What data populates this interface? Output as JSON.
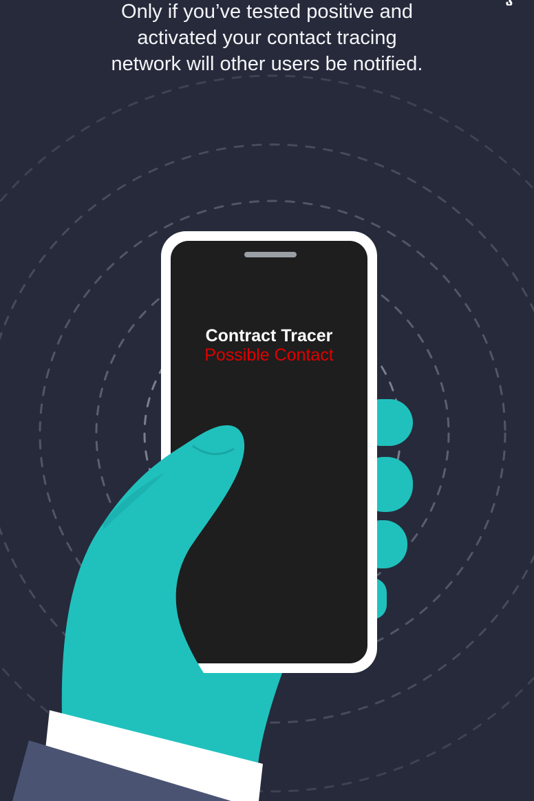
{
  "caption": {
    "line1": "Only if you’ve tested positive and",
    "line2": "activated your contact tracing",
    "line3": "network will other users be notified."
  },
  "phone": {
    "app_title": "Contract Tracer",
    "status": "Possible Contact",
    "status_color": "#e00000"
  },
  "illustration": {
    "background_color": "#262a3b",
    "glove_color": "#20c1bd",
    "sleeve_color": "#4a5472",
    "cuff_color": "#ffffff",
    "phone_screen_color": "#1e1e1e",
    "ring_color": "#5d6272"
  }
}
